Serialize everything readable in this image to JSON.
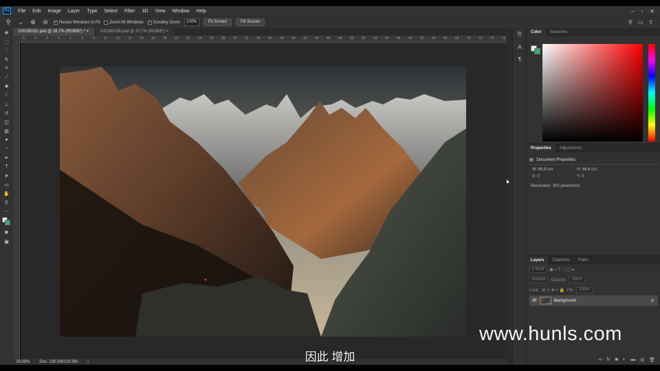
{
  "app": {
    "logo": "Ps"
  },
  "menu": [
    "File",
    "Edit",
    "Image",
    "Layer",
    "Type",
    "Select",
    "Filter",
    "3D",
    "View",
    "Window",
    "Help"
  ],
  "window_controls": [
    "–",
    "▫",
    "✕"
  ],
  "options": {
    "resize_windows": "Resize Windows to Fit",
    "zoom_all": "Zoom All Windows",
    "scrubby": "Scrubby Zoom",
    "zoom_value": "100%",
    "fit_screen": "Fit Screen",
    "fill_screen": "Fill Screen"
  },
  "tabs": [
    {
      "label": "DSC8522c.psd @ 28,7% (RGB/8*) *",
      "close": "×"
    },
    {
      "label": "DSC8522B.psd @ 27,7% (RGB/8*)",
      "close": "×"
    }
  ],
  "ruler_ticks": [
    "6",
    "4",
    "2",
    "0",
    "2",
    "4",
    "6",
    "8",
    "10",
    "12",
    "14",
    "16",
    "18",
    "20",
    "22",
    "24",
    "26",
    "28",
    "30",
    "32",
    "34",
    "36",
    "38",
    "40",
    "42",
    "44",
    "46",
    "48",
    "50",
    "52",
    "54",
    "56",
    "58",
    "60",
    "62",
    "64",
    "66",
    "68",
    "70",
    "72",
    "74",
    "76"
  ],
  "status": {
    "zoom": "28,69%",
    "doc": "Doc: 130,0M/130,0M"
  },
  "color_panel": {
    "tabs": [
      "Color",
      "Swatches"
    ],
    "accent_bg": "#3aaa6e"
  },
  "properties": {
    "tabs": [
      "Properties",
      "Adjustments"
    ],
    "title": "Document Properties",
    "w": "W: 66,9 cm",
    "h": "H: 46,6 cm",
    "x": "X: 0",
    "y": "Y: 0",
    "resolution": "Resolution: 300 pixels/inch"
  },
  "layers": {
    "tabs": [
      "Layers",
      "Channels",
      "Paths"
    ],
    "kind": "ρ Kind",
    "blend": "Normal",
    "opacity_label": "Opacity:",
    "opacity_value": "100%",
    "lock_label": "Lock:",
    "fill_label": "Fill:",
    "fill_value": "100%",
    "layer_name": "Background"
  },
  "watermark": "www.hunls.com",
  "subtitle": "因此 增加"
}
